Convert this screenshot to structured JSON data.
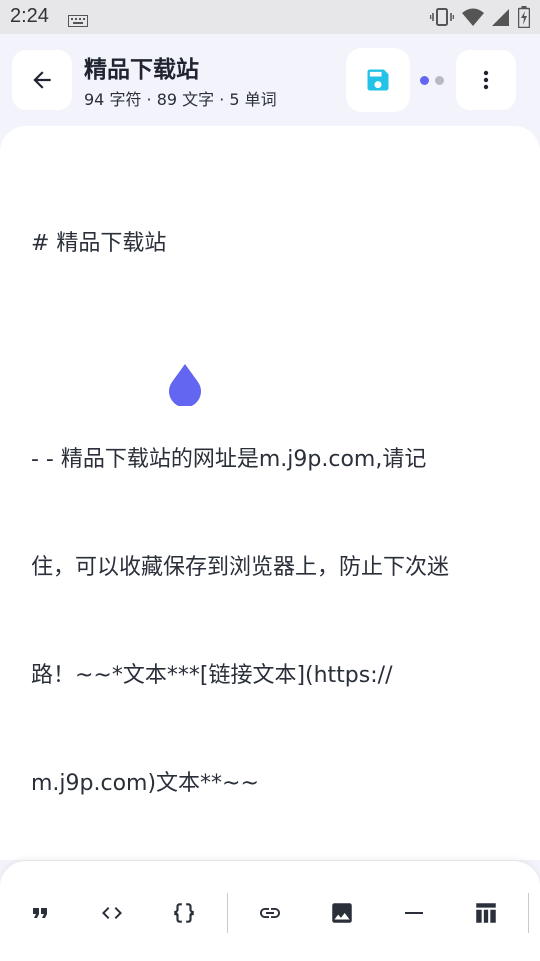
{
  "status_bar": {
    "time": "2:24",
    "icons": [
      "keyboard-icon",
      "vibrate-icon",
      "wifi-icon",
      "signal-icon",
      "battery-icon"
    ]
  },
  "header": {
    "title": "精品下载站",
    "subtitle": "94 字符 · 89 文字 · 5 单词",
    "buttons": [
      "back-arrow-icon",
      "save-icon",
      "more-vert-icon"
    ],
    "page_indicator_colors": [
      "#6366f1",
      "#b7b9c4"
    ]
  },
  "editor": {
    "lines": [
      "# 精品下载站",
      "",
      "- - 精品下载站的网址是m.j9p.com,请记",
      "住，可以收藏保存到浏览器上，防止下次迷",
      "路！~~*文本***[链接文本](https://",
      "m.j9p.com)文本**~~"
    ],
    "cursor_color": "#6366f1"
  },
  "toolbar": {
    "tools": [
      "quote-icon",
      "code-icon",
      "code-block-icon",
      "link-icon",
      "image-icon",
      "horizontal-rule-icon",
      "table-icon"
    ]
  },
  "colors": {
    "accent": "#6366f1",
    "save_icon": "#22c3e6",
    "background": "#f3f4fb"
  }
}
